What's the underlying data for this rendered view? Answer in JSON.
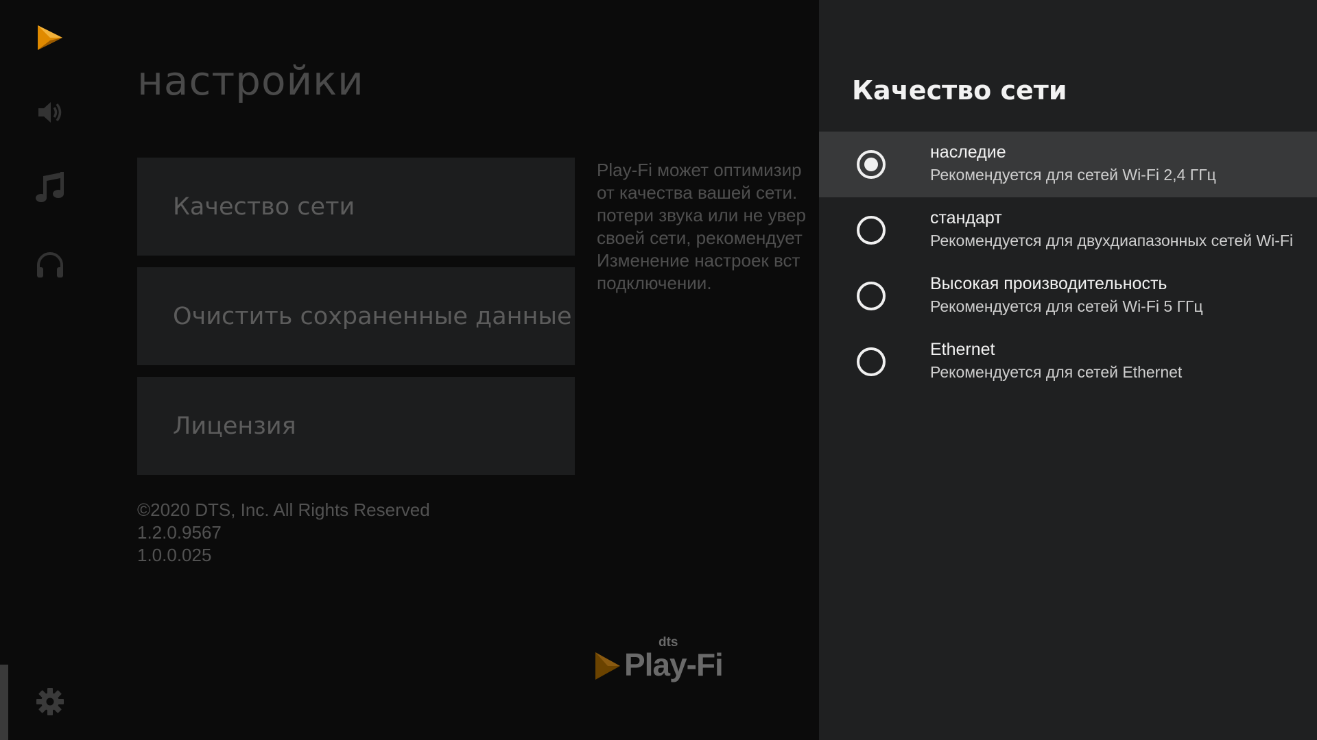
{
  "nav": {
    "items": [
      {
        "icon": "playfi-logo-icon"
      },
      {
        "icon": "speaker-volume-icon"
      },
      {
        "icon": "music-note-icon"
      },
      {
        "icon": "headphones-icon"
      },
      {
        "icon": "gear-icon",
        "active": true
      }
    ],
    "accent_color": "#e08a00"
  },
  "settings": {
    "title": "настройки",
    "menu": [
      {
        "label": "Качество сети"
      },
      {
        "label": "Очистить сохраненные данные"
      },
      {
        "label": "Лицензия"
      }
    ],
    "description_lines": [
      "Play-Fi может оптимизир",
      "от качества вашей сети.",
      "потери звука или не увер",
      "своей сети, рекомендует",
      "Изменение настроек вст",
      "подключении."
    ],
    "copyright": "©2020 DTS, Inc. All Rights Reserved",
    "version_1": "1.2.0.9567",
    "version_2": "1.0.0.025",
    "brand": {
      "prefix": "dts",
      "name": "Play-Fi"
    }
  },
  "panel": {
    "title": "Качество сети",
    "options": [
      {
        "title": "наследие",
        "subtitle": "Рекомендуется для сетей Wi-Fi 2,4 ГГц",
        "selected": true
      },
      {
        "title": "стандарт",
        "subtitle": "Рекомендуется для двухдиапазонных сетей Wi-Fi",
        "selected": false
      },
      {
        "title": "Высокая производительность",
        "subtitle": "Рекомендуется для сетей Wi-Fi 5 ГГц",
        "selected": false
      },
      {
        "title": "Ethernet",
        "subtitle": "Рекомендуется для сетей Ethernet",
        "selected": false
      }
    ]
  }
}
